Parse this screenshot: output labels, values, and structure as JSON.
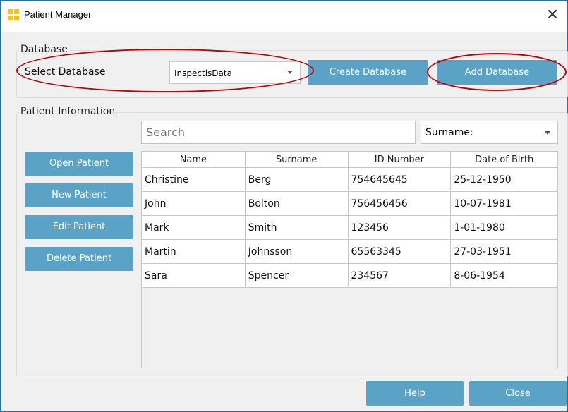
{
  "window": {
    "title": "Patient Manager",
    "close_glyph": "✕"
  },
  "database": {
    "group_title": "Database",
    "select_label": "Select Database",
    "selected_database": "InspectisData",
    "create_button": "Create Database",
    "add_button": "Add Database"
  },
  "patient": {
    "group_title": "Patient Information",
    "search_placeholder": "Search",
    "filter_selected": "Surname:",
    "actions": [
      "Open Patient",
      "New Patient",
      "Edit Patient",
      "Delete Patient"
    ],
    "columns": [
      "Name",
      "Surname",
      "ID Number",
      "Date of Birth"
    ],
    "rows": [
      [
        "Christine",
        "Berg",
        "754645645",
        "25-12-1950"
      ],
      [
        "John",
        "Bolton",
        "756456456",
        "10-07-1981"
      ],
      [
        "Mark",
        "Smith",
        "123456",
        "1-01-1980"
      ],
      [
        "Martin",
        "Johnsson",
        "65563345",
        "27-03-1951"
      ],
      [
        "Sara",
        "Spencer",
        "234567",
        "8-06-1954"
      ]
    ]
  },
  "footer": {
    "help_button": "Help",
    "close_button": "Close"
  },
  "colors": {
    "button": "#5ba3c6",
    "annotation": "#c40000",
    "icon": "#ffc20e"
  },
  "icons": [
    "app-grid-icon",
    "close-icon",
    "chevron-down-icon"
  ]
}
